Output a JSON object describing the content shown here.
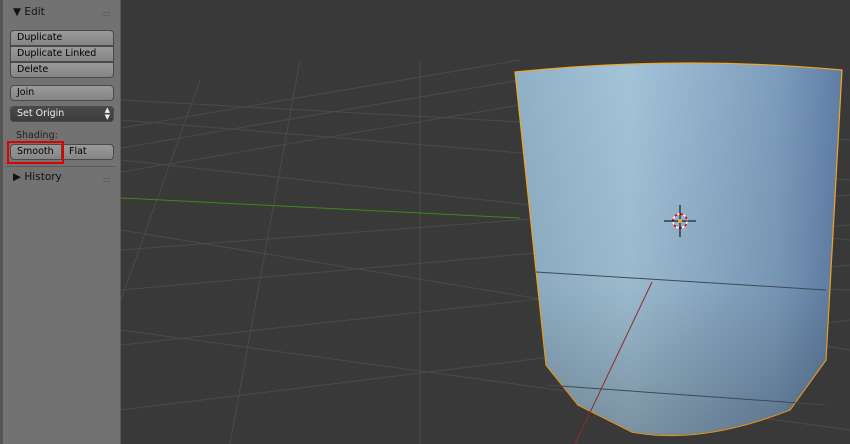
{
  "panel": {
    "edit_header": "▼ Edit",
    "buttons": {
      "duplicate": "Duplicate",
      "duplicate_linked": "Duplicate Linked",
      "delete": "Delete",
      "join": "Join"
    },
    "set_origin": "Set Origin",
    "shading_label": "Shading:",
    "smooth": "Smooth",
    "flat": "Flat",
    "history_header": "▶ History",
    "grip": ":::::"
  },
  "colors": {
    "highlight": "#e00000",
    "selection_outline": "#f5a623",
    "x_axis": "#8a2d2d",
    "y_axis": "#3a8a1a"
  }
}
